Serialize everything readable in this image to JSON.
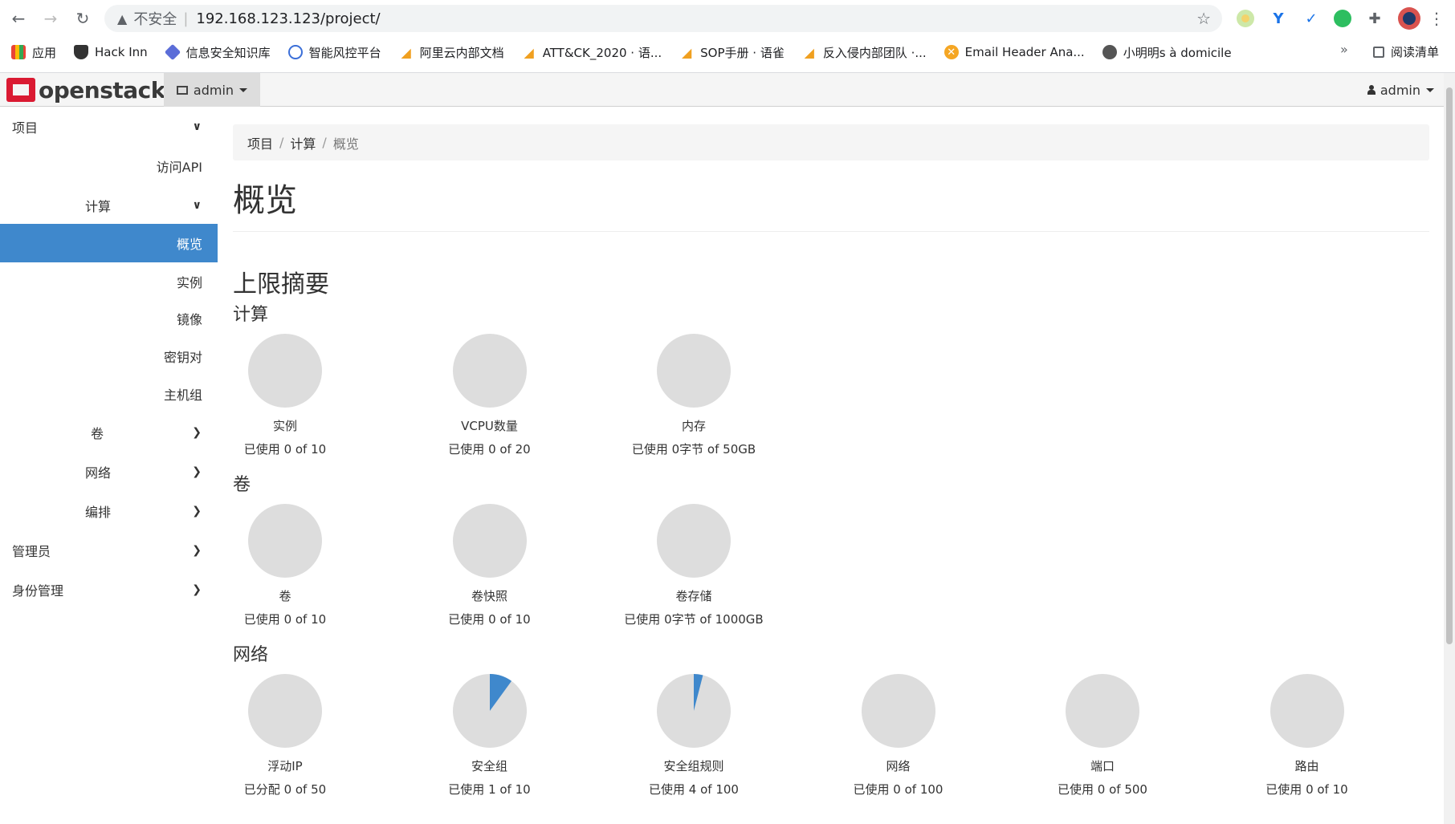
{
  "browser": {
    "back_icon": "←",
    "forward_icon": "→",
    "reload_icon": "↻",
    "warn_icon": "▲",
    "insecure_label": "不安全",
    "separator": "|",
    "url": "192.168.123.123/project/",
    "star_icon": "☆",
    "menu_icon": "⋮",
    "extensions": [
      "extension-icon",
      "extension-icon",
      "extension-icon",
      "evernote-icon",
      "puzzle-icon",
      "avatar"
    ]
  },
  "bookmarks": {
    "items": [
      {
        "label": "应用",
        "color": "#4285f4"
      },
      {
        "label": "Hack Inn",
        "color": "#333333"
      },
      {
        "label": "信息安全知识库",
        "color": "#5b6dd8"
      },
      {
        "label": "智能风控平台",
        "color": "#3b6fd8"
      },
      {
        "label": "阿里云内部文档",
        "color": "#f0a020"
      },
      {
        "label": "ATT&CK_2020 · 语...",
        "color": "#f0a020"
      },
      {
        "label": "SOP手册 · 语雀",
        "color": "#f0a020"
      },
      {
        "label": "反入侵内部团队 ·...",
        "color": "#f0a020"
      },
      {
        "label": "Email Header Ana...",
        "color": "#f5a623"
      },
      {
        "label": "小明明s à domicile",
        "color": "#555555"
      }
    ],
    "more": "»",
    "reading_list": "阅读清单"
  },
  "navbar": {
    "logo_text": "openstack.",
    "project": "admin",
    "user": "admin",
    "user_icon": "👤"
  },
  "sidebar": {
    "items": [
      {
        "label": "项目",
        "chev": "⌄"
      },
      {
        "label": "访问API",
        "chev": ""
      },
      {
        "label": "计算",
        "chev": "⌄"
      },
      {
        "label": "概览",
        "chev": ""
      },
      {
        "label": "实例",
        "chev": ""
      },
      {
        "label": "镜像",
        "chev": ""
      },
      {
        "label": "密钥对",
        "chev": ""
      },
      {
        "label": "主机组",
        "chev": ""
      },
      {
        "label": "卷",
        "chev": "›"
      },
      {
        "label": "网络",
        "chev": "›"
      },
      {
        "label": "编排",
        "chev": "›"
      },
      {
        "label": "管理员",
        "chev": "›"
      },
      {
        "label": "身份管理",
        "chev": "›"
      }
    ]
  },
  "breadcrumb": [
    "项目",
    "计算",
    "概览"
  ],
  "page_title": "概览",
  "limit_summary_title": "上限摘要",
  "sections": [
    {
      "title": "计算",
      "quotas": [
        {
          "label": "实例",
          "usage": "已使用 0 of 10",
          "fraction": 0
        },
        {
          "label": "VCPU数量",
          "usage": "已使用 0 of 20",
          "fraction": 0
        },
        {
          "label": "内存",
          "usage": "已使用 0字节 of 50GB",
          "fraction": 0
        }
      ]
    },
    {
      "title": "卷",
      "quotas": [
        {
          "label": "卷",
          "usage": "已使用 0 of 10",
          "fraction": 0
        },
        {
          "label": "卷快照",
          "usage": "已使用 0 of 10",
          "fraction": 0
        },
        {
          "label": "卷存储",
          "usage": "已使用 0字节 of 1000GB",
          "fraction": 0
        }
      ]
    },
    {
      "title": "网络",
      "quotas": [
        {
          "label": "浮动IP",
          "usage": "已分配 0 of 50",
          "fraction": 0
        },
        {
          "label": "安全组",
          "usage": "已使用 1 of 10",
          "fraction": 0.1
        },
        {
          "label": "安全组规则",
          "usage": "已使用 4 of 100",
          "fraction": 0.04
        },
        {
          "label": "网络",
          "usage": "已使用 0 of 100",
          "fraction": 0
        },
        {
          "label": "端口",
          "usage": "已使用 0 of 500",
          "fraction": 0
        },
        {
          "label": "路由",
          "usage": "已使用 0 of 10",
          "fraction": 0
        }
      ]
    }
  ],
  "colors": {
    "pie_bg": "#dddddd",
    "pie_fill": "#3f88cc",
    "active": "#3f88cc"
  }
}
